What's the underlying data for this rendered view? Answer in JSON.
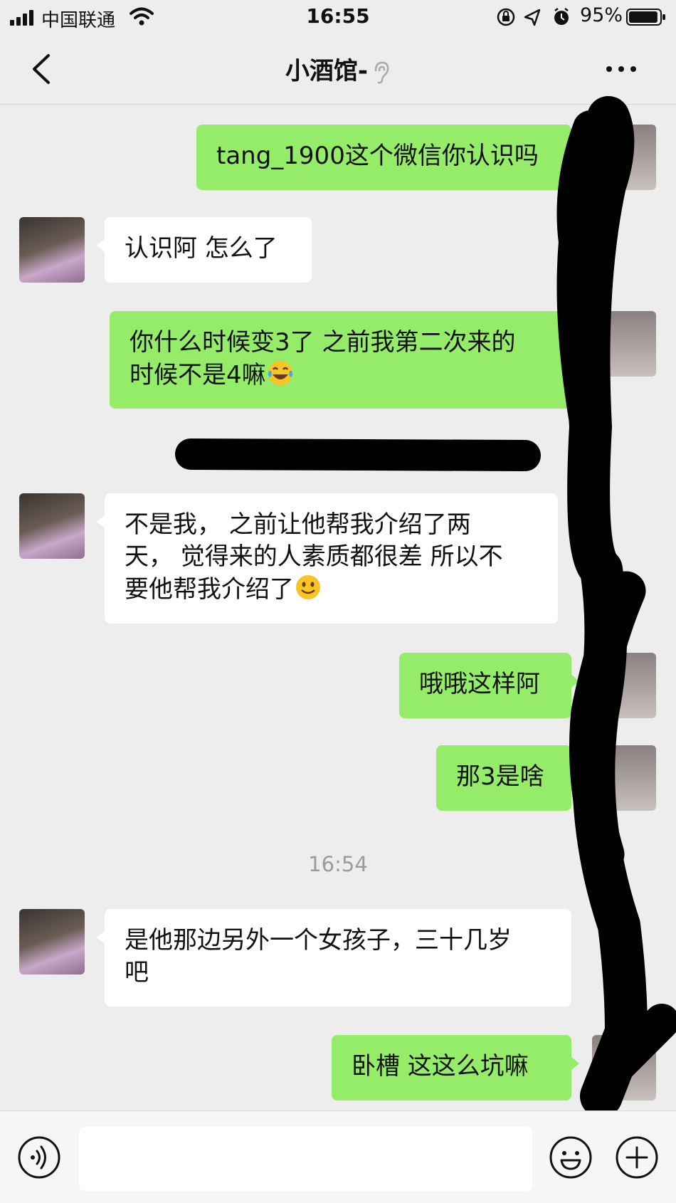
{
  "status_bar": {
    "carrier": "中国联通",
    "time": "16:55",
    "battery_percent": "95%",
    "battery_level": 0.95
  },
  "nav": {
    "title": "小酒馆-",
    "back_icon": "chevron-left-icon",
    "more_icon": "ellipsis-icon",
    "mode_icon": "ear-icon"
  },
  "messages": [
    {
      "from": "me",
      "text": "tang_1900这个微信你认识吗"
    },
    {
      "from": "them",
      "text": "认识阿 怎么了"
    },
    {
      "from": "me",
      "text": "你什么时候变3了 之前我第二次来的\n时候不是4嘛",
      "emoji": "tears-of-joy"
    },
    {
      "from": "them",
      "text": "不是我， 之前让他帮我介绍了两\n天， 觉得来的人素质都很差 所以不\n要他帮我介绍了",
      "emoji": "smile"
    },
    {
      "from": "me",
      "text": "哦哦这样阿"
    },
    {
      "from": "me",
      "text": "那3是啥"
    },
    {
      "type": "timestamp",
      "text": "16:54"
    },
    {
      "from": "them",
      "text": "是他那边另外一个女孩子，三十几岁\n吧"
    },
    {
      "from": "me",
      "text": "卧槽 这这么坑嘛"
    }
  ],
  "input_bar": {
    "text_value": "",
    "voice_icon": "voice-icon",
    "emoji_icon": "emoji-icon",
    "plus_icon": "plus-icon"
  },
  "colors": {
    "outgoing_bubble": "#95ec69",
    "incoming_bubble": "#ffffff",
    "background": "#ededed"
  }
}
